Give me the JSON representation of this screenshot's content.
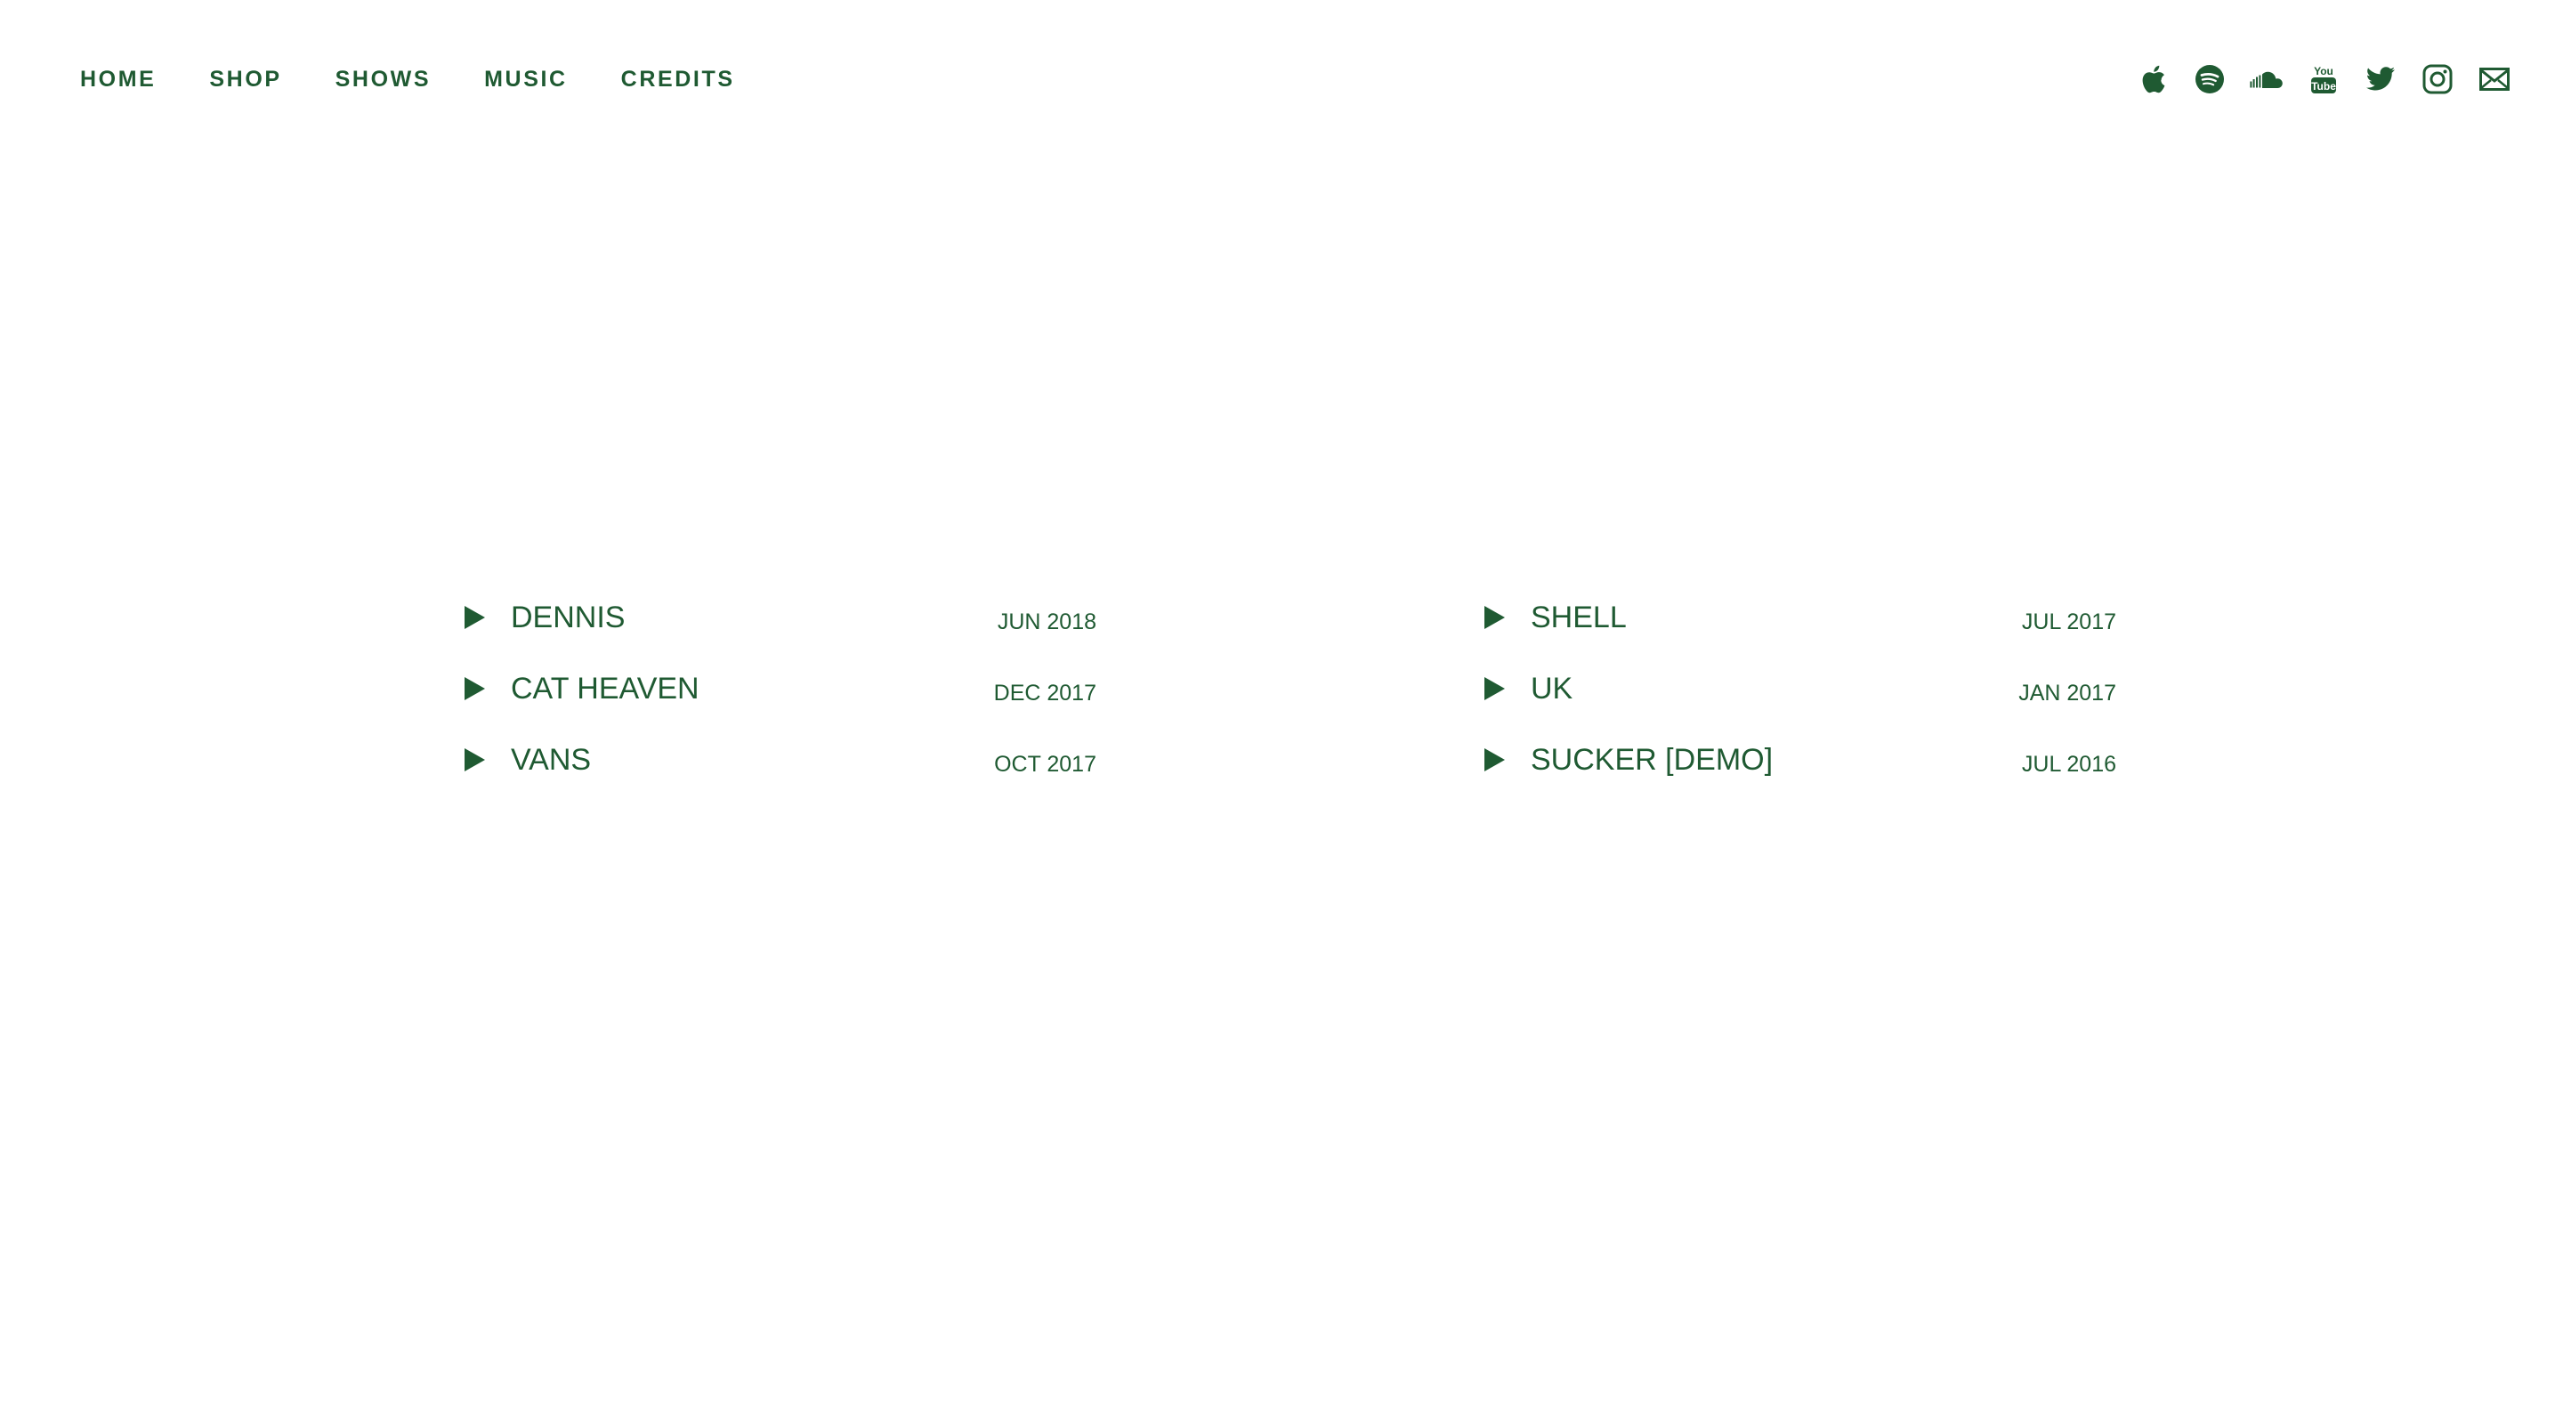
{
  "nav": {
    "items": [
      "HOME",
      "SHOP",
      "SHOWS",
      "MUSIC",
      "CREDITS"
    ]
  },
  "social": {
    "icons": [
      "apple-music-icon",
      "spotify-icon",
      "soundcloud-icon",
      "youtube-icon",
      "twitter-icon",
      "instagram-icon",
      "mail-icon"
    ],
    "youtube_top": "You",
    "youtube_bottom": "Tube"
  },
  "theme": {
    "accent": "#1f5a32",
    "background": "#ffffff"
  },
  "tracks": {
    "left": [
      {
        "title": "DENNIS",
        "date": "JUN 2018"
      },
      {
        "title": "CAT HEAVEN",
        "date": "DEC 2017"
      },
      {
        "title": "VANS",
        "date": "OCT 2017"
      }
    ],
    "right": [
      {
        "title": "SHELL",
        "date": "JUL 2017"
      },
      {
        "title": "UK",
        "date": "JAN 2017"
      },
      {
        "title": "SUCKER [DEMO]",
        "date": "JUL 2016"
      }
    ]
  }
}
